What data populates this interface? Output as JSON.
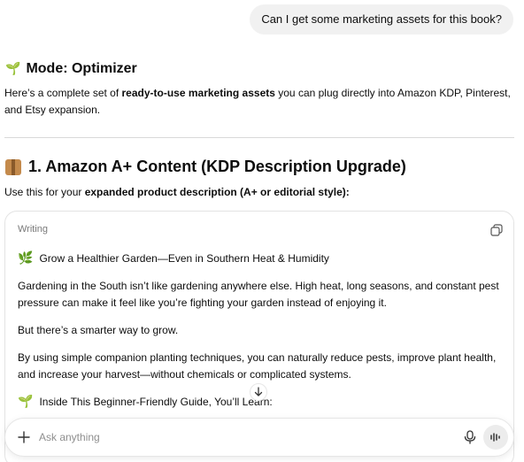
{
  "user_message": "Can I get some marketing assets for this book?",
  "mode": {
    "emoji": "🌱",
    "label": "Mode: Optimizer"
  },
  "intro": {
    "part1": "Here’s a complete set of ",
    "bold": "ready-to-use marketing assets",
    "part2": " you can plug directly into Amazon KDP, Pinterest, and Etsy expansion."
  },
  "section1": {
    "title": "1. Amazon A+ Content (KDP Description Upgrade)",
    "icon": "package-icon",
    "subline_prefix": "Use this for your ",
    "subline_bold": "expanded product description (A+ or editorial style):"
  },
  "card": {
    "label": "Writing",
    "headline_emoji": "🌿",
    "headline": "Grow a Healthier Garden—Even in Southern Heat & Humidity",
    "para1": "Gardening in the South isn’t like gardening anywhere else. High heat, long seasons, and constant pest pressure can make it feel like you’re fighting your garden instead of enjoying it.",
    "para2": "But there’s a smarter way to grow.",
    "para3": "By using simple companion planting techniques, you can naturally reduce pests, improve plant health, and increase your harvest—without chemicals or complicated systems.",
    "list_emoji": "🌱",
    "list_title": "Inside This Beginner-Friendly Guide, You’ll Learn:"
  },
  "composer": {
    "placeholder": "Ask anything"
  },
  "colors": {
    "bubble": "#f1f1f1",
    "text": "#0d0d0d",
    "muted": "#7a7a7a",
    "border": "#e3e3e3"
  }
}
